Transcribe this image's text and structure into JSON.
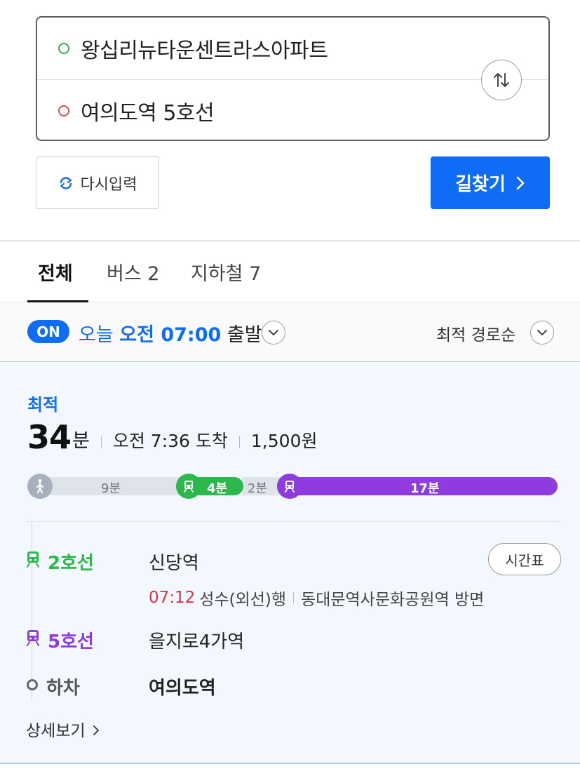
{
  "search": {
    "origin": "왕십리뉴타운센트라스아파트",
    "destination": "여의도역 5호선",
    "reset_label": "다시입력",
    "find_label": "길찾기"
  },
  "tabs": [
    {
      "label": "전체",
      "active": true
    },
    {
      "label": "버스 2",
      "active": false
    },
    {
      "label": "지하철 7",
      "active": false
    }
  ],
  "filter": {
    "on_badge": "ON",
    "day": "오늘",
    "time": "오전 07:00",
    "suffix": "출발",
    "sort_label": "최적 경로순"
  },
  "route": {
    "badge": "최적",
    "duration_value": "34",
    "duration_unit": "분",
    "arrival": "오전 7:36 도착",
    "fare": "1,500원",
    "segments": {
      "walk": "9분",
      "line2": "4분",
      "transfer": "2분",
      "line5": "17분"
    },
    "steps": {
      "s1_line": "2호선",
      "s1_station": "신당역",
      "timetable_label": "시간표",
      "s1_time": "07:12",
      "s1_direction": "성수(외선)행",
      "s1_toward": "동대문역사문화공원역 방면",
      "s2_line": "5호선",
      "s2_station": "을지로4가역",
      "s3_line": "하차",
      "s3_station": "여의도역"
    },
    "more_label": "상세보기"
  },
  "colors": {
    "accent": "#0f6cf5",
    "line2": "#2db84b",
    "line5": "#8e3be0",
    "time_red": "#e0323e"
  }
}
